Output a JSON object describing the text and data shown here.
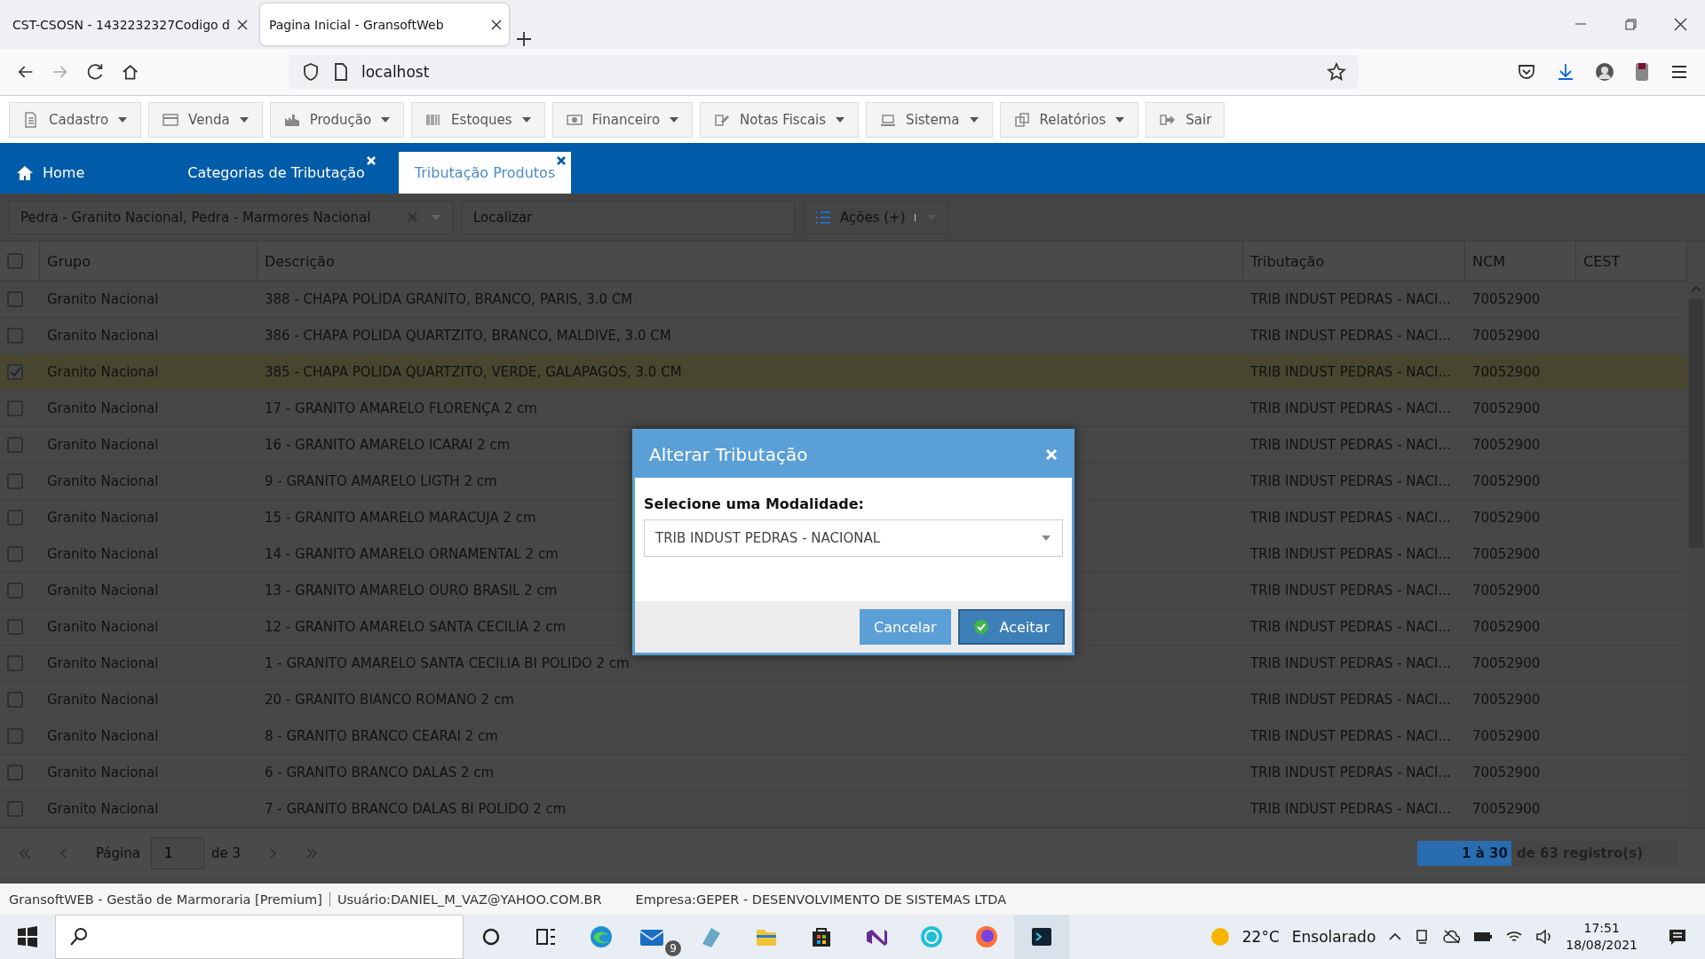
{
  "browser": {
    "tabs": [
      {
        "title": "CST-CSOSN - 1432232327Codigo d",
        "selected": false
      },
      {
        "title": "Pagina Inicial - GransoftWeb",
        "selected": true
      }
    ],
    "address": "localhost"
  },
  "menu": [
    {
      "label": "Cadastro",
      "dropdown": true
    },
    {
      "label": "Venda",
      "dropdown": true
    },
    {
      "label": "Produção",
      "dropdown": true
    },
    {
      "label": "Estoques",
      "dropdown": true
    },
    {
      "label": "Financeiro",
      "dropdown": true
    },
    {
      "label": "Notas Fiscais",
      "dropdown": true
    },
    {
      "label": "Sistema",
      "dropdown": true
    },
    {
      "label": "Relatórios",
      "dropdown": true
    },
    {
      "label": "Sair",
      "dropdown": false
    }
  ],
  "app_tabs": [
    {
      "label": "Home",
      "kind": "home",
      "selected": false
    },
    {
      "label": "Categorias de Tributação",
      "kind": "closable",
      "selected": false
    },
    {
      "label": "Tributação Produtos",
      "kind": "closable",
      "selected": true
    }
  ],
  "filter": {
    "value": "Pedra - Granito Nacional, Pedra - Marmores Nacional",
    "search_placeholder": "Localizar",
    "actions": "Ações (+)"
  },
  "table": {
    "all_checked": false,
    "columns": [
      "Grupo",
      "Descrição",
      "Tributação",
      "NCM",
      "CEST"
    ],
    "rows": [
      {
        "checked": false,
        "cells": [
          "Granito Nacional",
          "388 - CHAPA POLIDA GRANITO, BRANCO, PARIS, 3.0 CM",
          "TRIB INDUST PEDRAS - NACI...",
          "70052900"
        ]
      },
      {
        "checked": false,
        "cells": [
          "Granito Nacional",
          "386 - CHAPA POLIDA QUARTZITO, BRANCO, MALDIVE, 3.0 CM",
          "TRIB INDUST PEDRAS - NACI...",
          "70052900"
        ]
      },
      {
        "checked": true,
        "cells": [
          "Granito Nacional",
          "385 - CHAPA POLIDA QUARTZITO, VERDE, GALAPAGOS, 3.0 CM",
          "TRIB INDUST PEDRAS - NACI...",
          "70052900"
        ]
      },
      {
        "checked": false,
        "cells": [
          "Granito Nacional",
          "17 - GRANITO AMARELO FLORENÇA 2 cm",
          "TRIB INDUST PEDRAS - NACI...",
          "70052900"
        ]
      },
      {
        "checked": false,
        "cells": [
          "Granito Nacional",
          "16 - GRANITO AMARELO ICARAI 2 cm",
          "TRIB INDUST PEDRAS - NACI...",
          "70052900"
        ]
      },
      {
        "checked": false,
        "cells": [
          "Granito Nacional",
          "9 - GRANITO AMARELO LIGTH 2 cm",
          "TRIB INDUST PEDRAS - NACI...",
          "70052900"
        ]
      },
      {
        "checked": false,
        "cells": [
          "Granito Nacional",
          "15 - GRANITO AMARELO MARACUJA 2 cm",
          "TRIB INDUST PEDRAS - NACI...",
          "70052900"
        ]
      },
      {
        "checked": false,
        "cells": [
          "Granito Nacional",
          "14 - GRANITO AMARELO ORNAMENTAL 2 cm",
          "TRIB INDUST PEDRAS - NACI...",
          "70052900"
        ]
      },
      {
        "checked": false,
        "cells": [
          "Granito Nacional",
          "13 - GRANITO AMARELO OURO BRASIL 2 cm",
          "TRIB INDUST PEDRAS - NACI...",
          "70052900"
        ]
      },
      {
        "checked": false,
        "cells": [
          "Granito Nacional",
          "12 - GRANITO AMARELO SANTA CECILIA 2 cm",
          "TRIB INDUST PEDRAS - NACI...",
          "70052900"
        ]
      },
      {
        "checked": false,
        "cells": [
          "Granito Nacional",
          "1 - GRANITO AMARELO SANTA CECILIA BI POLIDO 2 cm",
          "TRIB INDUST PEDRAS - NACI...",
          "70052900"
        ]
      },
      {
        "checked": false,
        "cells": [
          "Granito Nacional",
          "20 - GRANITO BIANCO ROMANO 2 cm",
          "TRIB INDUST PEDRAS - NACI...",
          "70052900"
        ]
      },
      {
        "checked": false,
        "cells": [
          "Granito Nacional",
          "8 - GRANITO BRANCO CEARAI 2 cm",
          "TRIB INDUST PEDRAS - NACI...",
          "70052900"
        ]
      },
      {
        "checked": false,
        "cells": [
          "Granito Nacional",
          "6 - GRANITO BRANCO DALAS 2 cm",
          "TRIB INDUST PEDRAS - NACI...",
          "70052900"
        ]
      },
      {
        "checked": false,
        "cells": [
          "Granito Nacional",
          "7 - GRANITO BRANCO DALAS BI POLIDO 2 cm",
          "TRIB INDUST PEDRAS - NACI...",
          "70052900"
        ]
      }
    ]
  },
  "pager": {
    "page_label": "Página",
    "page": "1",
    "of": "de 3",
    "range": "1 à 30",
    "total": "de 63 registro(s)"
  },
  "dialog": {
    "title": "Alterar Tributação",
    "label": "Selecione uma Modalidade:",
    "value": "TRIB INDUST PEDRAS - NACIONAL",
    "buttons": [
      {
        "label": "Cancelar",
        "kind": "secondary"
      },
      {
        "label": "Aceitar",
        "kind": "primary"
      }
    ]
  },
  "status": {
    "app": "GransoftWEB - Gestão de Marmoraria [Premium]",
    "user": "Usuário:DANIEL_M_VAZ@YAHOO.COM.BR",
    "company": "Empresa:GEPER - DESENVOLVIMENTO DE SISTEMAS LTDA"
  },
  "taskbar": {
    "mail_badge": "9",
    "temperature": "22°C",
    "weather": "Ensolarado",
    "time": "17:51",
    "date": "18/08/2021"
  }
}
